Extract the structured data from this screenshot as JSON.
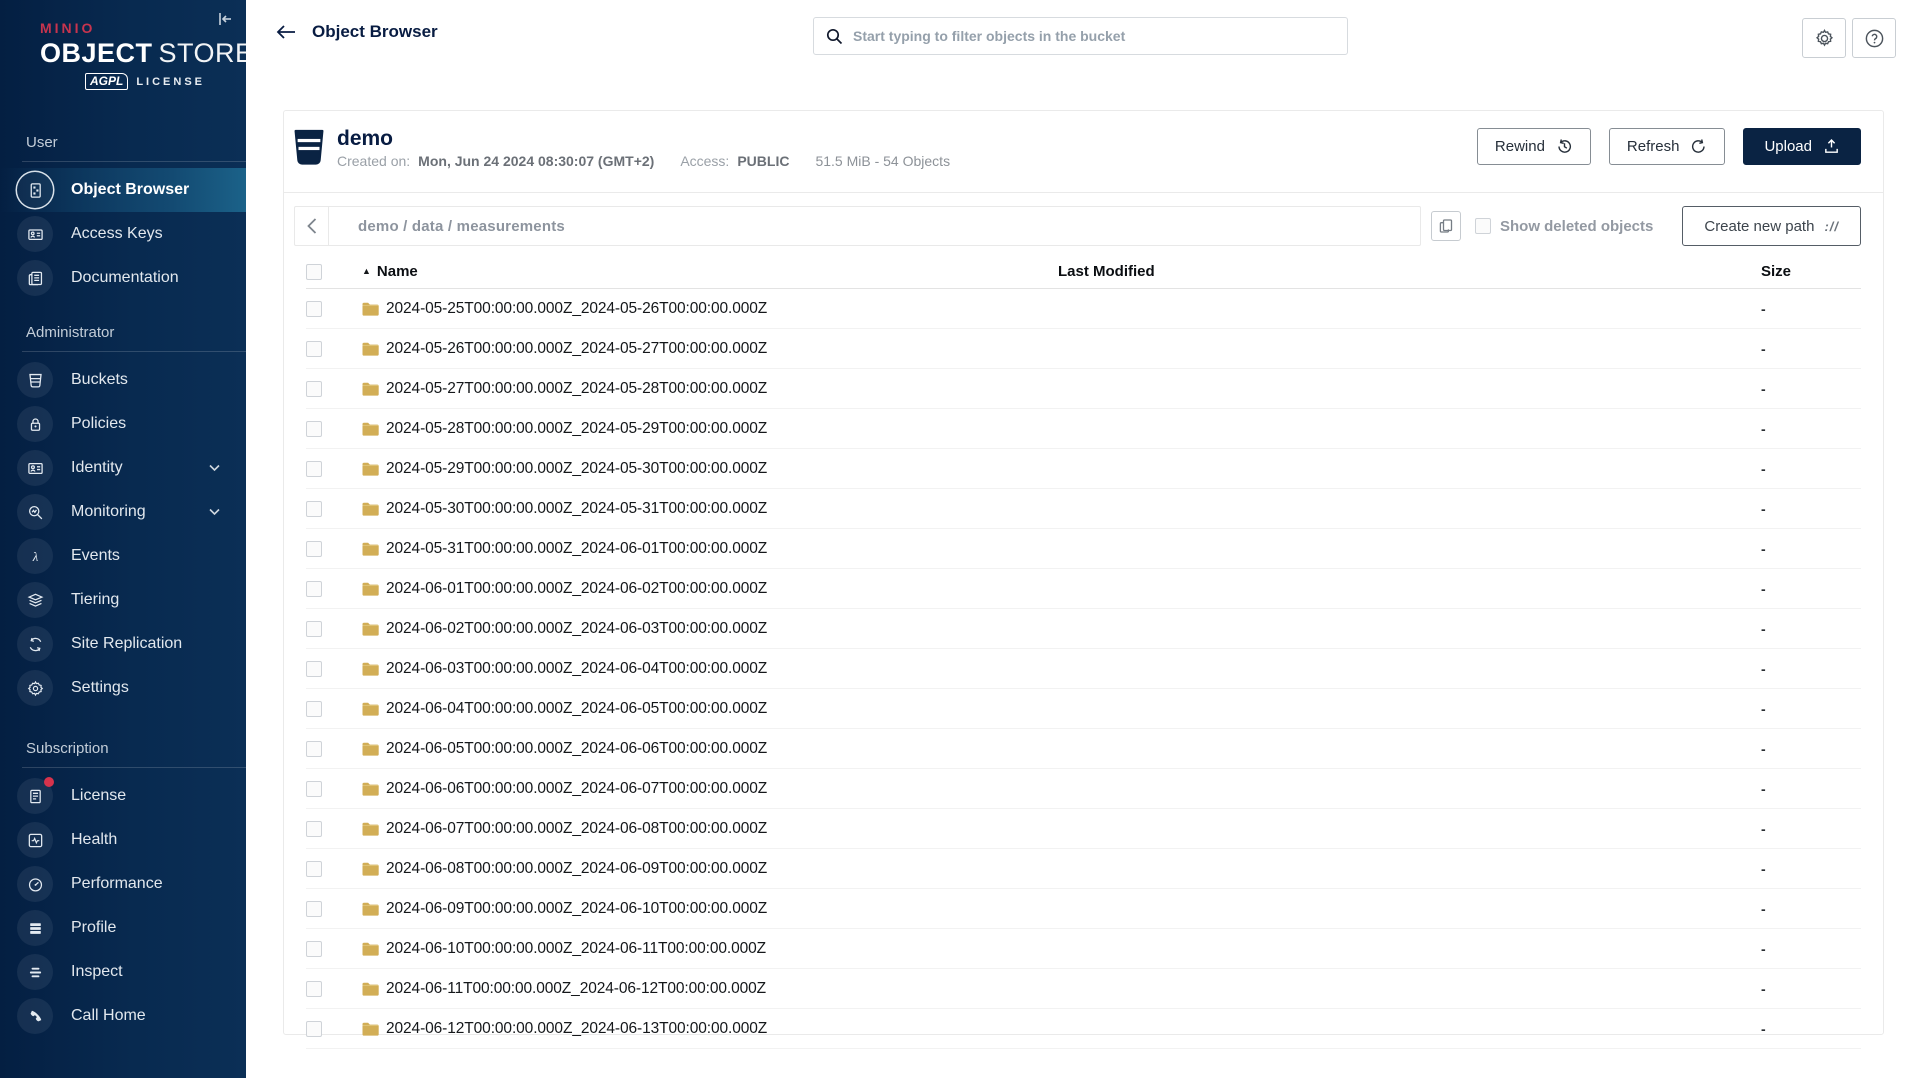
{
  "sidebar": {
    "logo": {
      "brand": "MINIO",
      "title_bold": "OBJECT",
      "title_light": "STORE",
      "badge": "AGPL",
      "license": "LICENSE"
    },
    "sections": [
      {
        "label": "User",
        "items": [
          {
            "label": "Object Browser",
            "icon": "object-browser-icon",
            "selected": true
          },
          {
            "label": "Access Keys",
            "icon": "access-keys-icon"
          },
          {
            "label": "Documentation",
            "icon": "documentation-icon"
          }
        ]
      },
      {
        "label": "Administrator",
        "items": [
          {
            "label": "Buckets",
            "icon": "buckets-icon"
          },
          {
            "label": "Policies",
            "icon": "policies-icon"
          },
          {
            "label": "Identity",
            "icon": "identity-icon",
            "expandable": true
          },
          {
            "label": "Monitoring",
            "icon": "monitoring-icon",
            "expandable": true
          },
          {
            "label": "Events",
            "icon": "events-icon"
          },
          {
            "label": "Tiering",
            "icon": "tiering-icon"
          },
          {
            "label": "Site Replication",
            "icon": "site-replication-icon"
          },
          {
            "label": "Settings",
            "icon": "settings-icon"
          }
        ]
      },
      {
        "label": "Subscription",
        "items": [
          {
            "label": "License",
            "icon": "license-icon",
            "badge": true
          },
          {
            "label": "Health",
            "icon": "health-icon"
          },
          {
            "label": "Performance",
            "icon": "performance-icon"
          },
          {
            "label": "Profile",
            "icon": "profile-icon"
          },
          {
            "label": "Inspect",
            "icon": "inspect-icon"
          },
          {
            "label": "Call Home",
            "icon": "call-home-icon"
          }
        ]
      }
    ]
  },
  "topbar": {
    "title": "Object Browser",
    "search_placeholder": "Start typing to filter objects in the bucket"
  },
  "bucket": {
    "name": "demo",
    "created_label": "Created on:",
    "created_value": "Mon, Jun 24 2024 08:30:07 (GMT+2)",
    "access_label": "Access:",
    "access_value": "PUBLIC",
    "usage": "51.5 MiB - 54 Objects",
    "rewind_label": "Rewind",
    "refresh_label": "Refresh",
    "upload_label": "Upload"
  },
  "browser": {
    "breadcrumb": "demo / data / measurements",
    "show_deleted_label": "Show deleted objects",
    "create_path_label": "Create new path",
    "path_icon_glyph": "://"
  },
  "table": {
    "columns": {
      "name": "Name",
      "last_modified": "Last Modified",
      "size": "Size"
    },
    "sort": {
      "column": "Name",
      "direction": "asc"
    },
    "rows": [
      {
        "name": "2024-05-25T00:00:00.000Z_2024-05-26T00:00:00.000Z",
        "last_modified": "",
        "size": "-"
      },
      {
        "name": "2024-05-26T00:00:00.000Z_2024-05-27T00:00:00.000Z",
        "last_modified": "",
        "size": "-"
      },
      {
        "name": "2024-05-27T00:00:00.000Z_2024-05-28T00:00:00.000Z",
        "last_modified": "",
        "size": "-"
      },
      {
        "name": "2024-05-28T00:00:00.000Z_2024-05-29T00:00:00.000Z",
        "last_modified": "",
        "size": "-"
      },
      {
        "name": "2024-05-29T00:00:00.000Z_2024-05-30T00:00:00.000Z",
        "last_modified": "",
        "size": "-"
      },
      {
        "name": "2024-05-30T00:00:00.000Z_2024-05-31T00:00:00.000Z",
        "last_modified": "",
        "size": "-"
      },
      {
        "name": "2024-05-31T00:00:00.000Z_2024-06-01T00:00:00.000Z",
        "last_modified": "",
        "size": "-"
      },
      {
        "name": "2024-06-01T00:00:00.000Z_2024-06-02T00:00:00.000Z",
        "last_modified": "",
        "size": "-"
      },
      {
        "name": "2024-06-02T00:00:00.000Z_2024-06-03T00:00:00.000Z",
        "last_modified": "",
        "size": "-"
      },
      {
        "name": "2024-06-03T00:00:00.000Z_2024-06-04T00:00:00.000Z",
        "last_modified": "",
        "size": "-"
      },
      {
        "name": "2024-06-04T00:00:00.000Z_2024-06-05T00:00:00.000Z",
        "last_modified": "",
        "size": "-"
      },
      {
        "name": "2024-06-05T00:00:00.000Z_2024-06-06T00:00:00.000Z",
        "last_modified": "",
        "size": "-"
      },
      {
        "name": "2024-06-06T00:00:00.000Z_2024-06-07T00:00:00.000Z",
        "last_modified": "",
        "size": "-"
      },
      {
        "name": "2024-06-07T00:00:00.000Z_2024-06-08T00:00:00.000Z",
        "last_modified": "",
        "size": "-"
      },
      {
        "name": "2024-06-08T00:00:00.000Z_2024-06-09T00:00:00.000Z",
        "last_modified": "",
        "size": "-"
      },
      {
        "name": "2024-06-09T00:00:00.000Z_2024-06-10T00:00:00.000Z",
        "last_modified": "",
        "size": "-"
      },
      {
        "name": "2024-06-10T00:00:00.000Z_2024-06-11T00:00:00.000Z",
        "last_modified": "",
        "size": "-"
      },
      {
        "name": "2024-06-11T00:00:00.000Z_2024-06-12T00:00:00.000Z",
        "last_modified": "",
        "size": "-"
      },
      {
        "name": "2024-06-12T00:00:00.000Z_2024-06-13T00:00:00.000Z",
        "last_modified": "",
        "size": "-"
      }
    ]
  },
  "colors": {
    "brand_red": "#c7344e",
    "navy": "#081C42",
    "sidebar_bg": "#082a50",
    "selected_item_gradient_end": "#1b6289",
    "folder": "#d2ae56",
    "border": "#eaeaea"
  }
}
